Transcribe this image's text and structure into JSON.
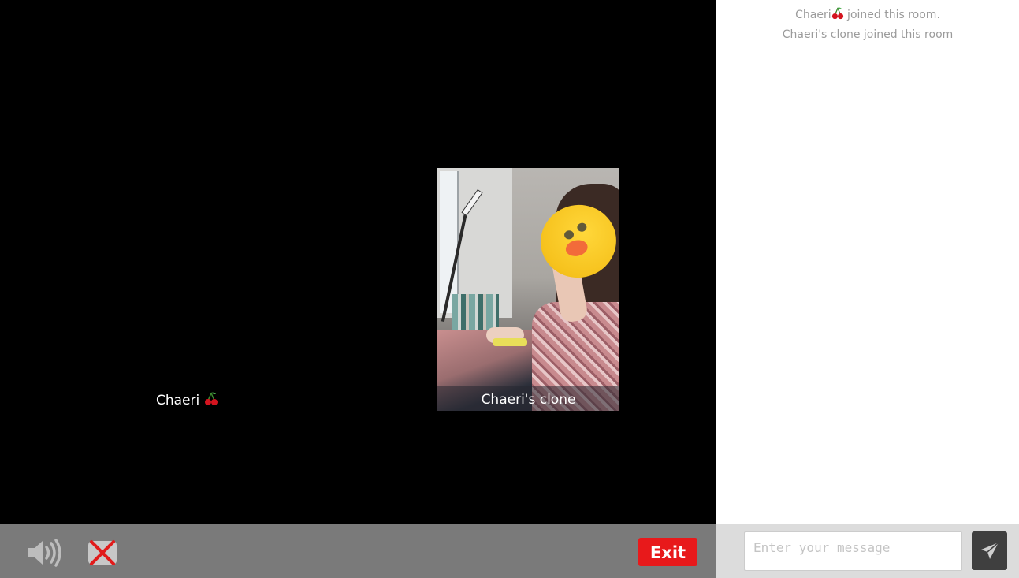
{
  "stage": {
    "local_participant": {
      "name": "Chaeri",
      "emoji_icon": "cherry-icon"
    },
    "remote_participant": {
      "name": "Chaeri's clone"
    }
  },
  "controls": {
    "speaker_icon": "speaker-icon",
    "camera_icon": "camera-off-icon",
    "exit_label": "Exit",
    "exit_color": "#e8191b"
  },
  "chat": {
    "messages": [
      {
        "prefix": "Chaeri",
        "emoji_icon": "cherry-icon",
        "suffix": " joined this room."
      },
      {
        "text": "Chaeri's clone joined this room"
      }
    ],
    "input": {
      "value": "",
      "placeholder": "Enter your message"
    },
    "send_icon": "paper-plane-icon"
  }
}
